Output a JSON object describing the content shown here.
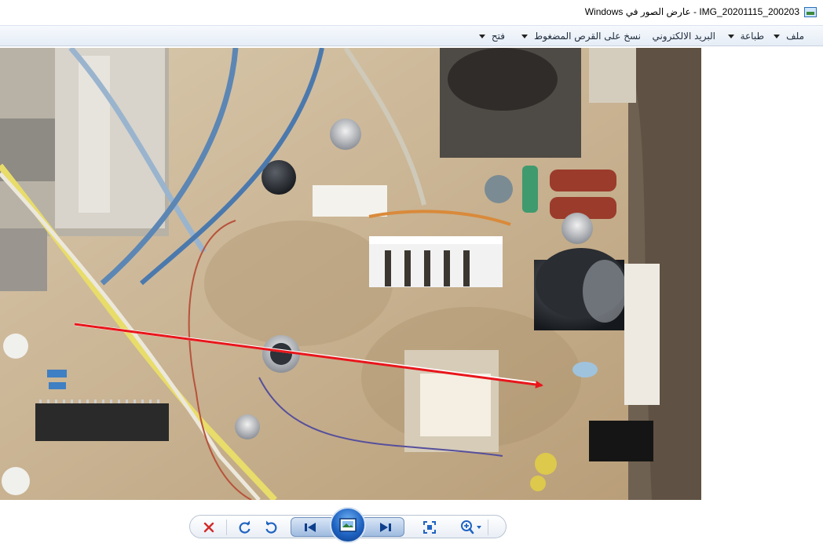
{
  "window": {
    "title": "IMG_20201115_200203 - عارض الصور في Windows"
  },
  "menu": {
    "items": [
      {
        "label": "ملف",
        "has_dropdown": true
      },
      {
        "label": "طباعة",
        "has_dropdown": true
      },
      {
        "label": "البريد الالكتروني",
        "has_dropdown": false
      },
      {
        "label": "نسخ على القرص المضغوط",
        "has_dropdown": true
      },
      {
        "label": "فتح",
        "has_dropdown": true
      }
    ]
  },
  "toolbar": {
    "buttons": [
      {
        "name": "delete",
        "icon": "red-x-icon"
      },
      {
        "name": "rotate-clockwise",
        "icon": "rotate-cw-icon"
      },
      {
        "name": "rotate-counterclockwise",
        "icon": "rotate-ccw-icon"
      },
      {
        "name": "previous",
        "icon": "skip-back-icon"
      },
      {
        "name": "slideshow",
        "icon": "slideshow-icon"
      },
      {
        "name": "next",
        "icon": "skip-forward-icon"
      },
      {
        "name": "actual-size",
        "icon": "fit-window-icon"
      },
      {
        "name": "zoom",
        "icon": "magnifier-plus-icon"
      }
    ]
  },
  "colors": {
    "annotation_arrow": "#e8161b",
    "accent_blue": "#1f63c2",
    "delete_red": "#d22a2a"
  }
}
